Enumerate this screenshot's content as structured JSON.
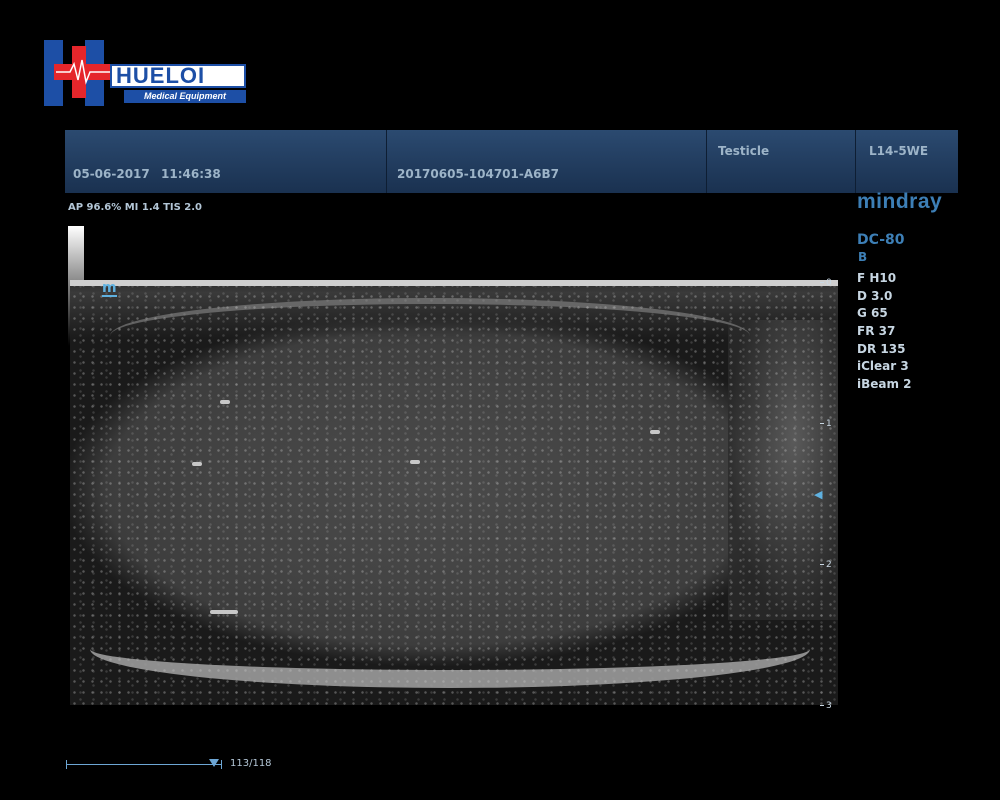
{
  "logo": {
    "brand": "HUELOI",
    "tagline": "Medical Equipment"
  },
  "header": {
    "date": "05-06-2017",
    "time": "11:46:38",
    "exam_id": "20170605-104701-A6B7",
    "exam_type": "Testicle",
    "probe": "L14-5WE"
  },
  "power_line": "AP 96.6%  MI 1.4  TIS 2.0",
  "vendor": {
    "brand": "mindray",
    "model": "DC-80",
    "mode": "B"
  },
  "params": [
    "F H10",
    "D 3.0",
    "G 65",
    "FR 37",
    "DR 135",
    "iClear 3",
    "iBeam 2"
  ],
  "main": {
    "marker_label": "m",
    "depth_scale": [
      "0",
      "1",
      "2",
      "3"
    ],
    "cine": {
      "frame_label": "113/118",
      "position": 0.958
    }
  }
}
